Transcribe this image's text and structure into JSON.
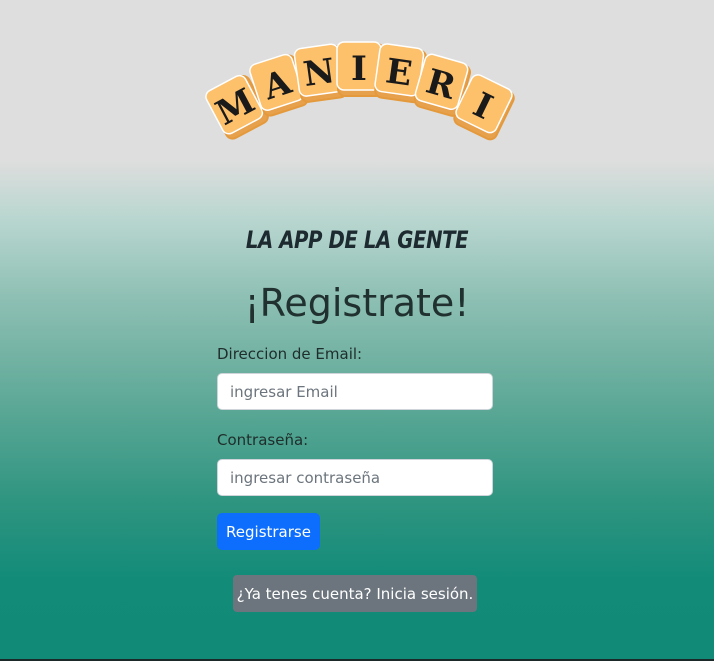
{
  "logo": {
    "text": "MANIERI",
    "letters": [
      "M",
      "A",
      "N",
      "I",
      "E",
      "R",
      "I"
    ],
    "tile_color": "#fdc06b",
    "tile_border": "#e49a3c"
  },
  "tagline": "LA APP DE LA GENTE",
  "title": "¡Registrate!",
  "form": {
    "email_label": "Direccion de Email:",
    "email_placeholder": "ingresar Email",
    "email_value": "",
    "password_label": "Contraseña:",
    "password_placeholder": "ingresar contraseña",
    "password_value": "",
    "submit_label": "Registrarse"
  },
  "login_link_label": "¿Ya tenes cuenta? Inicia sesión.",
  "colors": {
    "primary": "#0d6efd",
    "secondary": "#6c757d",
    "gradient_top": "#dedede",
    "gradient_bottom": "#118a78"
  }
}
